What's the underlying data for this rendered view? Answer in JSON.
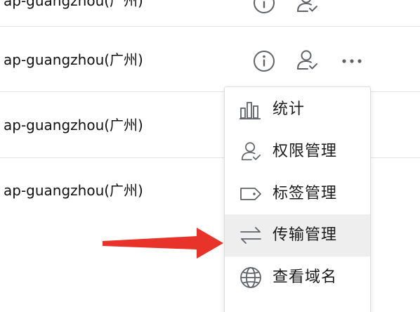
{
  "rows": [
    {
      "region_label": "ap-guangzhou(广州)"
    },
    {
      "region_label": "ap-guangzhou(广州)"
    },
    {
      "region_label": "ap-guangzhou(广州)"
    },
    {
      "region_label": "ap-guangzhou(广州)"
    }
  ],
  "menu": {
    "items": [
      {
        "label": "统计",
        "icon": "bar-chart-icon"
      },
      {
        "label": "权限管理",
        "icon": "user-permission-icon"
      },
      {
        "label": "标签管理",
        "icon": "tag-icon"
      },
      {
        "label": "传输管理",
        "icon": "transfer-arrows-icon"
      },
      {
        "label": "查看域名",
        "icon": "globe-icon"
      }
    ],
    "highlighted_item": "传输管理"
  },
  "colors": {
    "icon_gray": "#5f6368",
    "divider": "#e3e3e3",
    "menu_hover": "#eeeeee",
    "annotation_arrow": "#e8332a"
  }
}
